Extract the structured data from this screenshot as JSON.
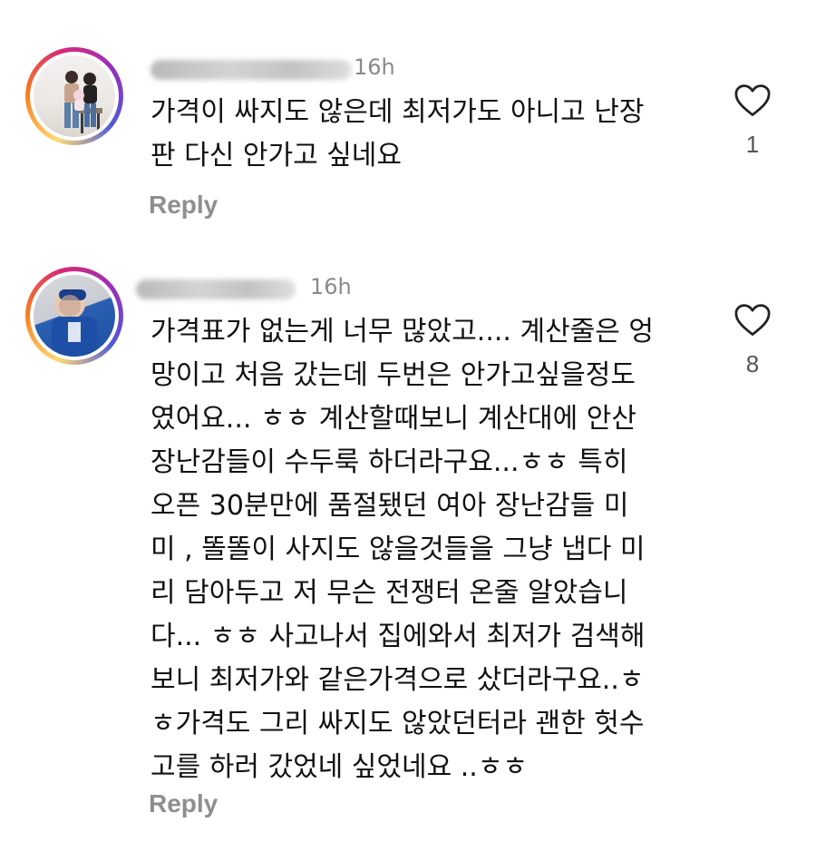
{
  "comments": [
    {
      "time": "16h",
      "text": "가격이 싸지도 않은데 최저가도 아니고 난장\n판 다신 안가고 싶네요",
      "reply_label": "Reply",
      "likes": "1"
    },
    {
      "time": "16h",
      "text": "가격표가 없는게 너무 많았고.... 계산줄은 엉\n망이고 처음 갔는데 두번은 안가고싶을정도\n였어요... ㅎㅎ 계산할때보니 계산대에 안산\n장난감들이 수두룩 하더라구요...ㅎㅎ 특히\n오픈 30분만에 품절됐던 여아 장난감들 미\n미 , 똘똘이 사지도 않을것들을 그냥 냅다 미\n리 담아두고 저 무슨 전쟁터 온줄 알았습니\n다... ㅎㅎ 사고나서 집에와서 최저가 검색해\n보니 최저가와 같은가격으로 샀더라구요..ㅎ\nㅎ가격도 그리 싸지도 않았던터라 괜한 헛수\n고를 하러 갔었네 싶었네요 ..ㅎㅎ",
      "reply_label": "Reply",
      "likes": "8"
    }
  ],
  "icons": {
    "like": "heart-outline-icon"
  },
  "colors": {
    "meta_gray": "#8a8a8a",
    "text": "#111111"
  }
}
